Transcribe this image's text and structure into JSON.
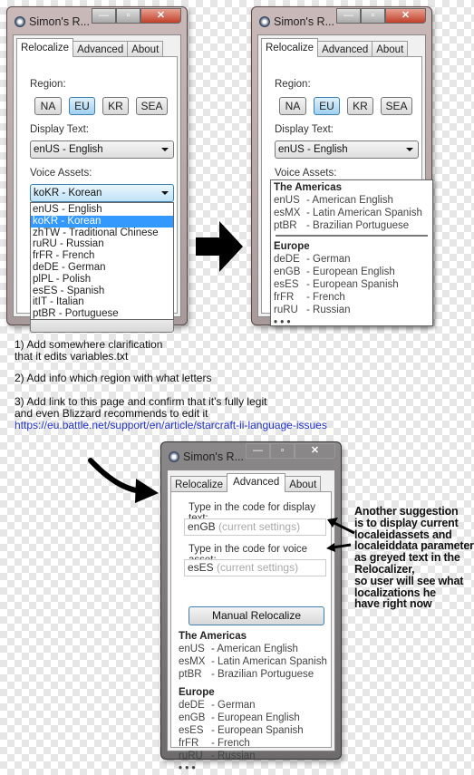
{
  "window_title": "Simon's R...",
  "tabs": [
    "Relocalize",
    "Advanced",
    "About"
  ],
  "relocalize": {
    "region_label": "Region:",
    "regions": [
      "NA",
      "EU",
      "KR",
      "SEA"
    ],
    "selected_region": "EU",
    "display_text_label": "Display Text:",
    "display_text_value": "enUS - English",
    "voice_assets_label": "Voice Assets:",
    "voice_assets_value": "koKR - Korean",
    "voice_options": [
      "enUS - English",
      "koKR - Korean",
      "zhTW - Traditional Chinese",
      "ruRU - Russian",
      "frFR - French",
      "deDE - German",
      "plPL - Polish",
      "esES - Spanish",
      "itIT - Italian",
      "ptBR - Portuguese"
    ]
  },
  "groups": {
    "americas_title": "The Americas",
    "americas": [
      {
        "code": "enUS",
        "name": "- American English"
      },
      {
        "code": "esMX",
        "name": "- Latin American Spanish"
      },
      {
        "code": "ptBR",
        "name": "- Brazilian Portuguese"
      }
    ],
    "europe_title": "Europe",
    "europe": [
      {
        "code": "deDE",
        "name": "- German"
      },
      {
        "code": "enGB",
        "name": "- European English"
      },
      {
        "code": "esES",
        "name": "- European Spanish"
      },
      {
        "code": "frFR",
        "name": "- French"
      },
      {
        "code": "ruRU",
        "name": "- Russian"
      }
    ],
    "more": "• • •"
  },
  "advanced": {
    "display_label": "Type in the code for display text:",
    "display_value": "enGB",
    "display_hint": "(current settings)",
    "voice_label": "Type in the code for voice asset:",
    "voice_value": "esES",
    "voice_hint": "(current settings)",
    "manual_button": "Manual Relocalize"
  },
  "notes": {
    "n1": "1) Add somewhere clarification\nthat it edits variables.txt",
    "n2": "2) Add info which region with what letters",
    "n3": "3) Add link to this page and confirm that it's fully legit\nand even Blizzard recommends to edit it",
    "link": "https://eu.battle.net/support/en/article/starcraft-ii-language-issues",
    "annotation": "Another suggestion\nis to display current\nlocaleidassets and\nlocaleiddata parameters\nas greyed text in the\nRelocalizer,\nso user will see what\nlocalizations he\nhave right now"
  }
}
